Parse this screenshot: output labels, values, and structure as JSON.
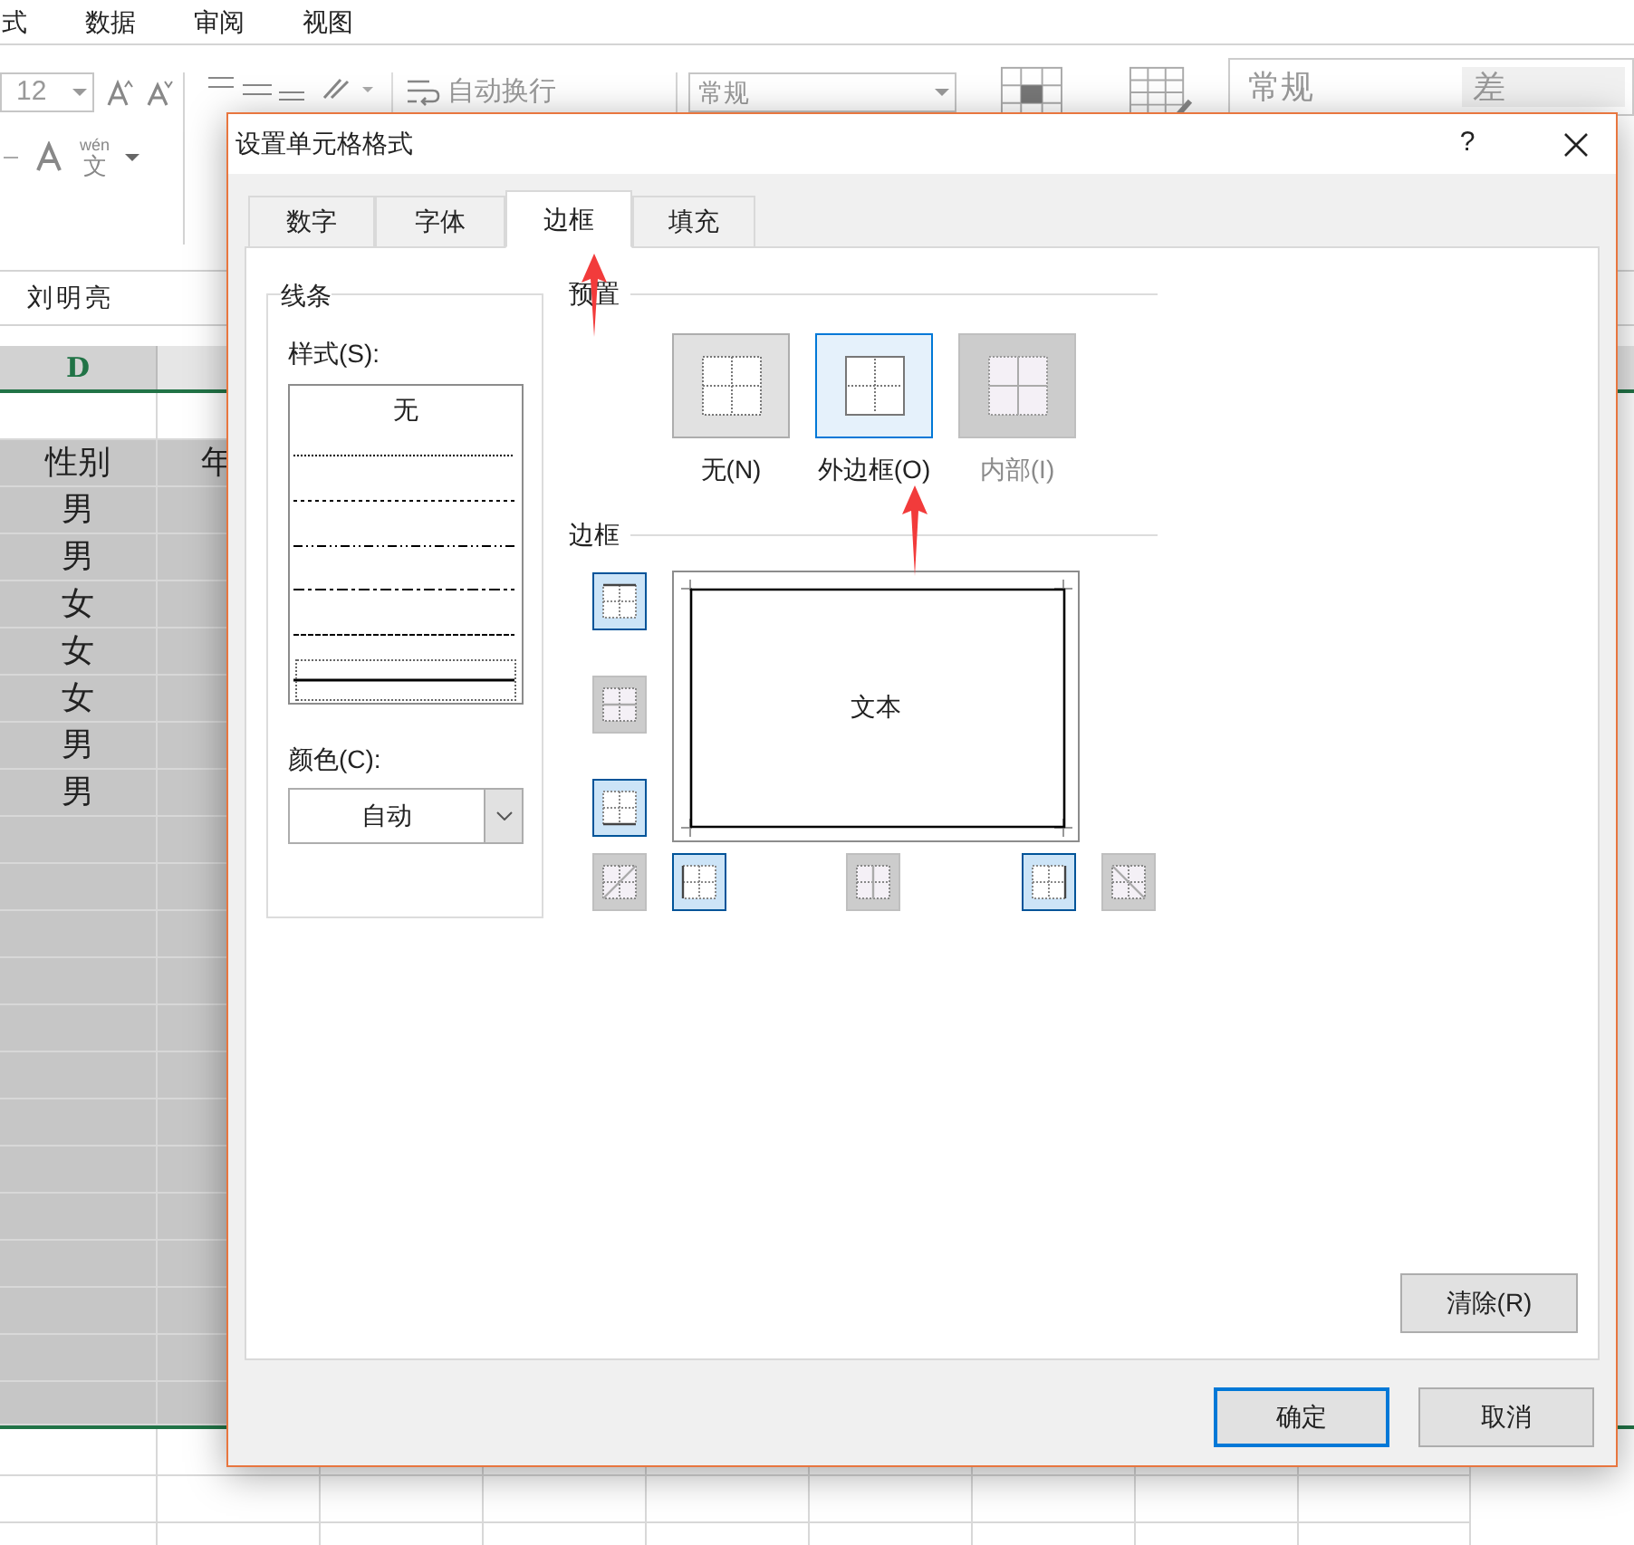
{
  "menu": [
    {
      "label": "式"
    },
    {
      "label": "数据"
    },
    {
      "label": "审阅"
    },
    {
      "label": "视图"
    }
  ],
  "ribbon": {
    "font_size": "12",
    "wrap_text": "自动换行",
    "number_format": "常规",
    "phonetic": "wén",
    "phonetic_char": "文",
    "styles": [
      {
        "label": "常规"
      },
      {
        "label": "差"
      }
    ]
  },
  "formula_bar": {
    "value": "刘明亮"
  },
  "sheet": {
    "columns": [
      {
        "label": "D"
      }
    ],
    "header_cells": [
      "性别",
      "年"
    ],
    "cells": [
      "男",
      "男",
      "女",
      "女",
      "女",
      "男",
      "男"
    ]
  },
  "dialog": {
    "title": "设置单元格格式",
    "help": "?",
    "tabs": [
      {
        "label": "数字",
        "selected": false
      },
      {
        "label": "字体",
        "selected": false
      },
      {
        "label": "边框",
        "selected": true
      },
      {
        "label": "填充",
        "selected": false
      }
    ],
    "line": {
      "title": "线条",
      "style_label": "样式(S):",
      "styles": [
        {
          "kind": "none",
          "label": "无",
          "selected": false
        },
        {
          "kind": "dotted",
          "selected": false
        },
        {
          "kind": "dashed_fine",
          "selected": false
        },
        {
          "kind": "dash_dot_dot",
          "selected": false
        },
        {
          "kind": "dash_dot",
          "selected": false
        },
        {
          "kind": "dashed",
          "selected": false
        },
        {
          "kind": "thin",
          "selected": true
        }
      ],
      "color_label": "颜色(C):",
      "color_value": "自动"
    },
    "presets_title": "预置",
    "presets": [
      {
        "kind": "none",
        "label": "无(N)",
        "selected": false,
        "disabled": false
      },
      {
        "kind": "outline",
        "label": "外边框(O)",
        "selected": true,
        "disabled": false
      },
      {
        "kind": "inside",
        "label": "内部(I)",
        "selected": false,
        "disabled": true
      }
    ],
    "border_title": "边框",
    "borders": [
      {
        "kind": "top",
        "on": true
      },
      {
        "kind": "middle_h",
        "on": false
      },
      {
        "kind": "bottom",
        "on": true
      },
      {
        "kind": "diag_up",
        "on": false
      },
      {
        "kind": "left",
        "on": true
      },
      {
        "kind": "middle_v",
        "on": false
      },
      {
        "kind": "right",
        "on": true
      },
      {
        "kind": "diag_down",
        "on": false
      }
    ],
    "preview_text": "文本",
    "clear_button": "清除(R)",
    "buttons": [
      {
        "label": "确定",
        "selected": true
      },
      {
        "label": "取消",
        "selected": false
      }
    ]
  }
}
